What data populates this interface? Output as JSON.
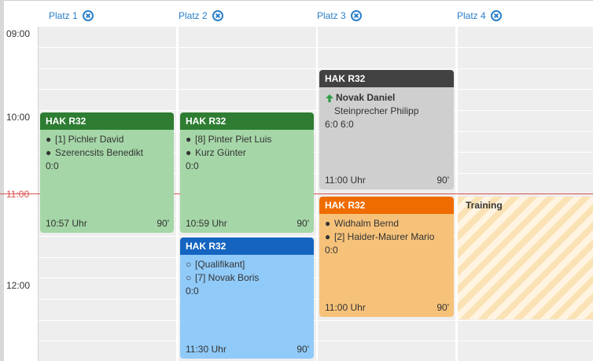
{
  "courts": [
    {
      "label": "Platz 1"
    },
    {
      "label": "Platz 2"
    },
    {
      "label": "Platz 3"
    },
    {
      "label": "Platz 4"
    }
  ],
  "times": [
    "09:00",
    "10:00",
    "11:00",
    "12:00"
  ],
  "now_label": "11:00",
  "colors": {
    "green": "#2e7d32",
    "green_body": "#a5d6a7",
    "blue": "#1565c0",
    "blue_body": "#90caf9",
    "dark": "#424242",
    "grey_body": "#cfcfcf",
    "orange": "#ef6c00",
    "orange_body": "#f6c27a",
    "accent": "#2a7fc8",
    "now": "#d9534f"
  },
  "events": {
    "e1": {
      "title": "HAK R32",
      "players": [
        "[1] Pichler David",
        "Szerencsits Benedikt"
      ],
      "score": "0:0",
      "time": "10:57 Uhr",
      "duration": "90'"
    },
    "e2": {
      "title": "HAK R32",
      "players": [
        "[8] Pinter Piet Luis",
        "Kurz Günter"
      ],
      "score": "0:0",
      "time": "10:59 Uhr",
      "duration": "90'"
    },
    "e3": {
      "title": "HAK R32",
      "players": [
        "[Qualifikant]",
        "[7] Novak Boris"
      ],
      "score": "0:0",
      "time": "11:30 Uhr",
      "duration": "90'"
    },
    "e4": {
      "title": "HAK R32",
      "winner": "Novak Daniel",
      "loser": "Steinprecher Philipp",
      "score": "6:0 6:0",
      "time": "11:00 Uhr",
      "duration": "90'"
    },
    "e5": {
      "title": "HAK R32",
      "players": [
        "Widhalm Bernd",
        "[2] Haider-Maurer Mario"
      ],
      "score": "0:0",
      "time": "11:00 Uhr",
      "duration": "90'"
    }
  },
  "training": {
    "label": "Training"
  }
}
